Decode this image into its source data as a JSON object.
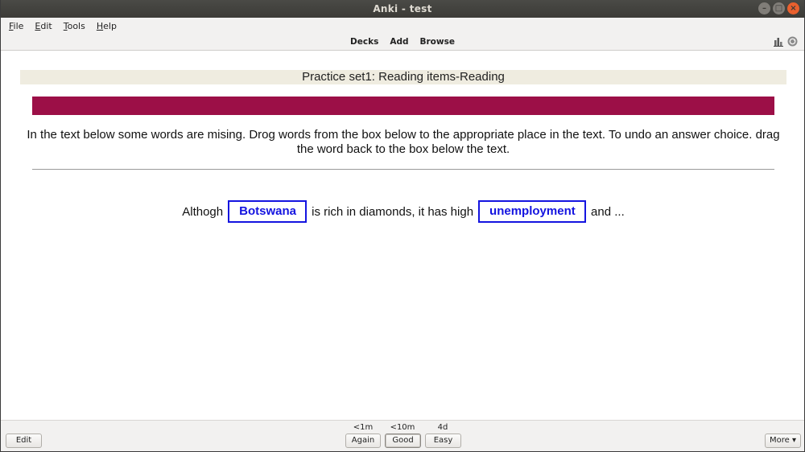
{
  "window": {
    "title": "Anki - test",
    "minimize": "–",
    "maximize": "□",
    "close": "×"
  },
  "menu": {
    "file": {
      "underline": "F",
      "rest": "ile"
    },
    "edit": {
      "underline": "E",
      "rest": "dit"
    },
    "tools": {
      "underline": "T",
      "rest": "ools"
    },
    "help": {
      "underline": "H",
      "rest": "elp"
    }
  },
  "toolbar": {
    "decks": "Decks",
    "add": "Add",
    "browse": "Browse",
    "icons": [
      "stats-icon",
      "sync-icon"
    ]
  },
  "card": {
    "header": "Practice set1: Reading items-Reading",
    "bar_color": "#9c0f47",
    "instructions": "In the text below some words are mising. Drog words from the box below to the appropriate place in the text. To undo an answer choice. drag the word back to the box below the text.",
    "sentence": {
      "part1": "Althogh",
      "blank1": "Botswana",
      "part2": "is rich in diamonds, it has high",
      "blank2": "unemployment",
      "part3": "and ..."
    },
    "answer_color": "#1414e0"
  },
  "bottom": {
    "edit_label": "Edit",
    "more_label": "More ▾",
    "answers": [
      {
        "interval": "<1m",
        "label": "Again"
      },
      {
        "interval": "<10m",
        "label": "Good"
      },
      {
        "interval": "4d",
        "label": "Easy"
      }
    ]
  }
}
